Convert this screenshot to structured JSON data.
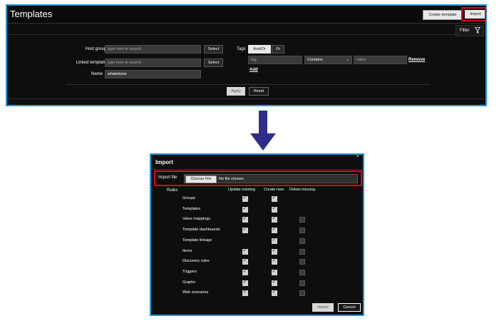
{
  "templates_page": {
    "title": "Templates",
    "create_template_label": "Create template",
    "import_label": "Import",
    "filter_label": "Filter",
    "filter": {
      "host_groups_label": "Host groups",
      "host_groups_placeholder": "type here to search",
      "linked_templates_label": "Linked templates",
      "linked_templates_placeholder": "type here to search",
      "select_label": "Select",
      "name_label": "Name",
      "name_value": "whalebone",
      "tags_label": "Tags",
      "tags_andor_label": "And/Or",
      "tags_or_label": "Or",
      "tag_placeholder": "tag",
      "tag_operator": "Contains",
      "value_placeholder": "value",
      "remove_label": "Remove",
      "add_label": "Add",
      "apply_label": "Apply",
      "reset_label": "Reset"
    }
  },
  "import_dialog": {
    "title": "Import",
    "import_file_label": "Import file",
    "choose_file_label": "Choose File",
    "no_file_text": "No file chosen",
    "rules_label": "Rules",
    "columns": {
      "update_existing": "Update existing",
      "create_new": "Create new",
      "delete_missing": "Delete missing"
    },
    "rules": [
      {
        "name": "Groups",
        "update": true,
        "create": true,
        "delete": null
      },
      {
        "name": "Templates",
        "update": true,
        "create": true,
        "delete": null
      },
      {
        "name": "Value mappings",
        "update": true,
        "create": true,
        "delete": false
      },
      {
        "name": "Template dashboards",
        "update": true,
        "create": true,
        "delete": false
      },
      {
        "name": "Template linkage",
        "update": null,
        "create": true,
        "delete": false
      },
      {
        "name": "Items",
        "update": true,
        "create": true,
        "delete": false
      },
      {
        "name": "Discovery rules",
        "update": true,
        "create": true,
        "delete": false
      },
      {
        "name": "Triggers",
        "update": true,
        "create": true,
        "delete": false
      },
      {
        "name": "Graphs",
        "update": true,
        "create": true,
        "delete": false
      },
      {
        "name": "Web scenarios",
        "update": true,
        "create": true,
        "delete": false
      }
    ],
    "import_button_label": "Import",
    "cancel_button_label": "Cancel"
  },
  "colors": {
    "highlight": "#e0001b",
    "frame": "#1b9ad8",
    "background": "#0e0e0e",
    "arrow": "#2e2e8a"
  }
}
